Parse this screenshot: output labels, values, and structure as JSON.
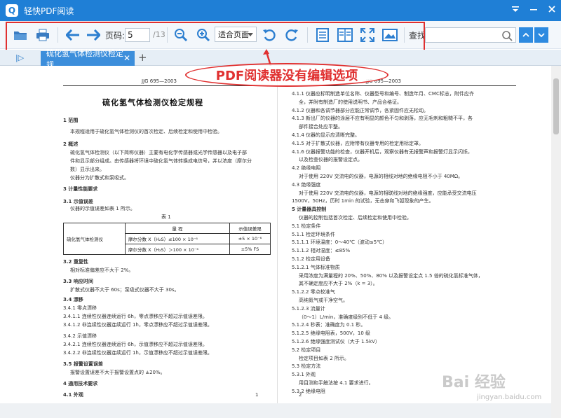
{
  "app": {
    "title": "轻快PDF阅读",
    "logo": "Q"
  },
  "window": {
    "min_icon": "minimize-icon",
    "max_icon": "maximize-icon",
    "close_icon": "close-icon"
  },
  "toolbar": {
    "page_label": "页码:",
    "page_value": "5",
    "page_total": "/13",
    "fit_option": "适合页面",
    "search_label": "查找:",
    "search_placeholder": ""
  },
  "tabs": [
    {
      "label": "硫化氢气体检测仪检定规..."
    }
  ],
  "annotation": {
    "text": "PDF阅读器没有编辑选项",
    "color": "#e03030"
  },
  "colors": {
    "accent": "#1f7fd6",
    "tab": "#3c8edb",
    "highlight": "#e03030"
  },
  "watermark": {
    "text": "Bai 经验",
    "url": "jingyan.baidu.com"
  },
  "left_page": {
    "header": "JJG 695—2003",
    "title": "硫化氢气体检测仪检定规程",
    "lines": [
      "1  范围",
      "本规程适用于硫化氢气体检测仪的首次检定、后续检定和使用中检验。",
      "2  概述",
      "硫化氢气体检测仪（以下简称仪器）主要有电化学传感器或光学传感器以及电子部",
      "件和显示部分组成。由传感器将环境中硫化氢气体转换成电信号，并以浓度（摩尔分",
      "数）显示出来。",
      "仪器分为扩散式和泵吸式。",
      "3  计量性能要求",
      "3.1  示值误差",
      "仪器的示值误差如表 1 所示。",
      "3.2  重复性",
      "相对标准偏差应不大于 2%。",
      "3.3  响应时间",
      "扩散式仪器不大于 60s；泵吸式仪器不大于 30s。",
      "3.4  漂移",
      "3.4.1  零点漂移",
      "3.4.1.1  连续性仪器连续运行 6h，零点漂移应不超过示值误差限。",
      "3.4.1.2  非连续性仪器连续运行 1h，零点漂移应不超过示值误差限。",
      "3.4.2  示值漂移",
      "3.4.2.1  连续性仪器连续运行 6h，示值漂移应不超过示值误差限。",
      "3.4.2.2  非连续性仪器连续运行 1h，示值漂移应不超过示值误差限。",
      "3.5  报警设置误差",
      "报警设置误差不大于报警设置点的 ±20%。",
      "4  通用技术要求",
      "4.1  外观"
    ],
    "table": {
      "caption": "表 1",
      "head": [
        "量    程",
        "示值误差限"
      ],
      "row_label": "硫化氢气体检测仪",
      "rows": [
        [
          "摩尔分数 X（H₂S）≤100 × 10⁻⁶",
          "±5 × 10⁻⁶"
        ],
        [
          "摩尔分数 X（H₂S）＞100 × 10⁻⁶",
          "±5% FS"
        ]
      ]
    },
    "page_no": "1"
  },
  "right_page": {
    "header": "JJG 695—2003",
    "lines": [
      "4.1.1  仪器应标明制造单位名称、仪器型号和编号、制造年月、CMC标志，附件应齐",
      "全，并附有制造厂的使用说明书、产品合格证。",
      "4.1.2  仪器和各调节器部分应能正常调节，各紧固件应无松动。",
      "4.1.3  新出厂的仪器的涂层不应有明显的颜色不匀和剥落，应无毛刺和粗糙不平，各",
      "部件接合处应平整。",
      "4.1.4  仪器的显示应清晰完整。",
      "4.1.5  对于扩散式仪器，应附带有仪器专用的检定用标定罩。",
      "4.1.6  仪器报警功能的检查，仪器开机后，观察仪器有无报警声和报警灯显示闪烁，",
      "以及检查仪器的报警设定点。",
      "4.2  绝缘电阻",
      "对于使用 220V 交流电的仪器，电源的相线对地的绝缘电阻不小于 40MΩ。",
      "4.3  绝缘强度",
      "对于使用 220V 交流电的仪器，电源的相联线对地的绝缘强度，应能承受交流电压",
      "1500V，50Hz，历时 1min 的试验，无击穿和飞弧现象的产生。",
      "5  计量器具控制",
      "仪器的控制包括首次检定、后续检定和使用中检验。",
      "5.1  检定条件",
      "5.1.1  检定环境条件",
      "5.1.1.1  环境温度：0～40℃（波动≤5℃）",
      "5.1.1.2  相对湿度：≤85%",
      "5.1.2  检定用设备",
      "5.1.2.1  气体标准物质",
      "采用浓度为满量程的 20%、50%、80% 以及报警设定点 1.5 倍的硫化氢标准气体，",
      "其不确定度应不大于 2%（k = 3）。",
      "5.1.2.2  零点校准气",
      "高纯氮气或干净空气。",
      "5.1.2.3  流量计",
      "（0～1）L/min，准确度级别不低于 4 级。",
      "5.1.2.4  秒表：准确度为 0.1 秒。",
      "5.1.2.5  绝缘电阻表，500V，10 级",
      "5.1.2.6  绝缘强度测试仪（大于 1.5kV）",
      "5.2  检定项目",
      "检定项目如表 2 所示。",
      "5.3  检定方法",
      "5.3.1  外观",
      "用目测和手触法按 4.1 要求进行。",
      "5.3.2  绝缘电阻"
    ],
    "page_no": "2"
  }
}
